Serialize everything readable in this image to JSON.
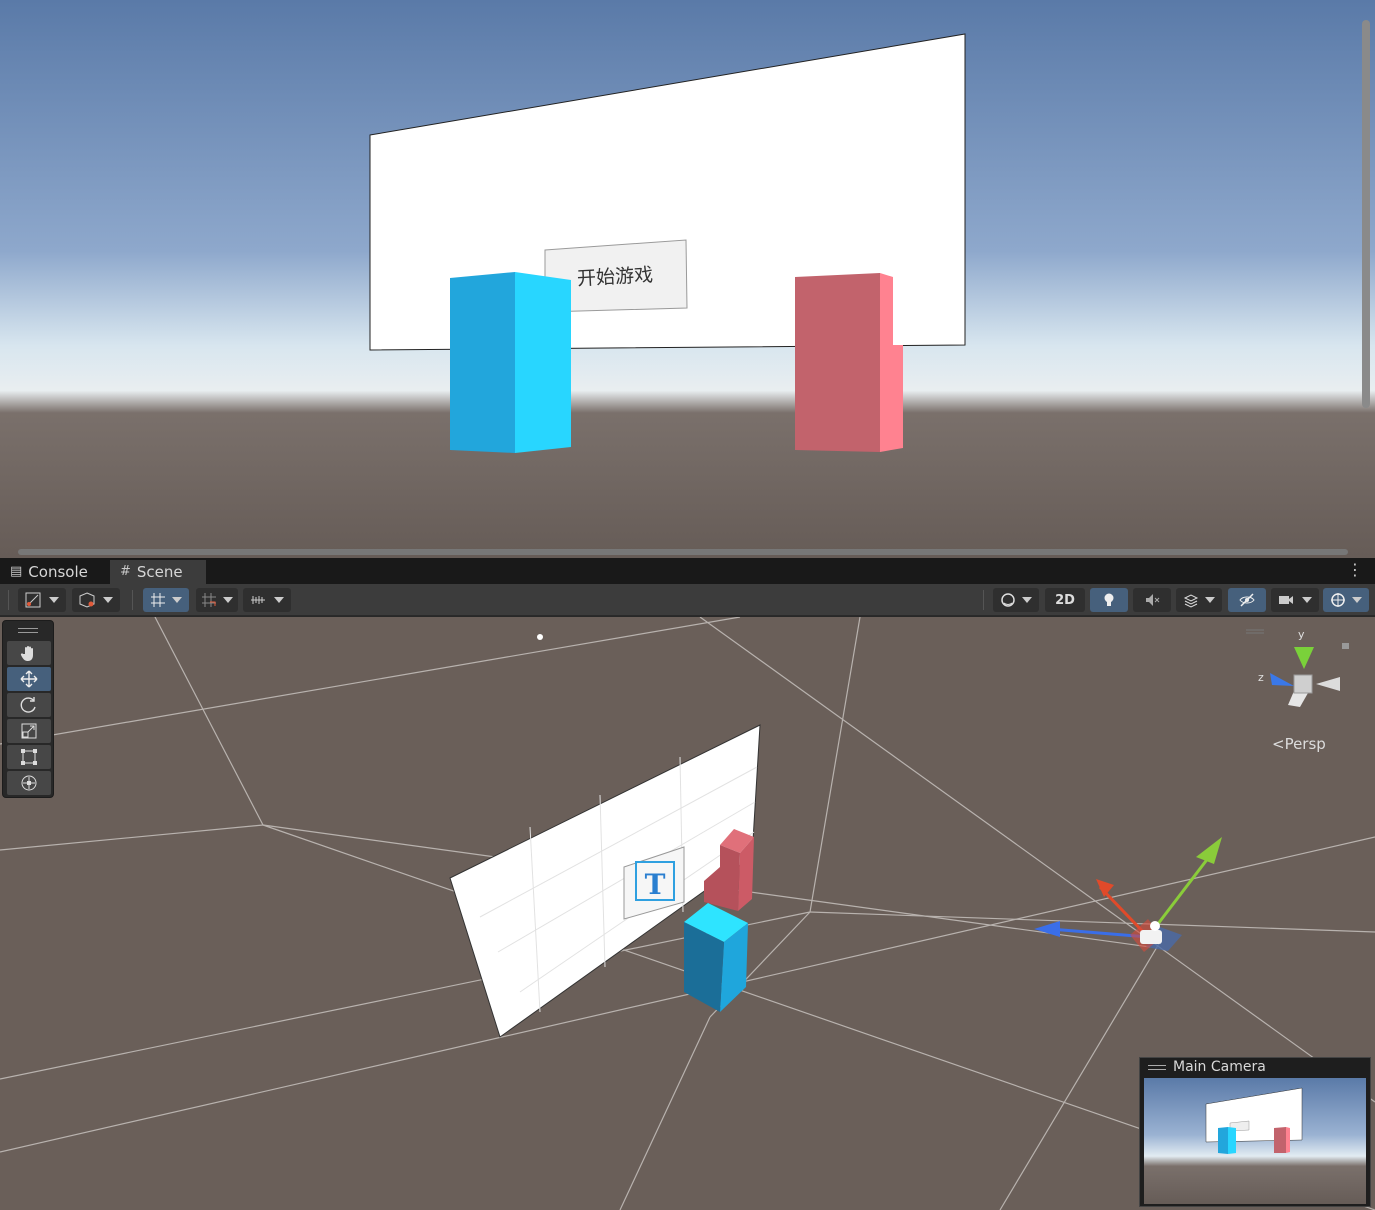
{
  "game_view": {
    "button_label": "开始游戏"
  },
  "tabs": [
    {
      "label": "Console",
      "icon": "console-icon",
      "active": false
    },
    {
      "label": "Scene",
      "icon": "scene-grid-icon",
      "active": true
    }
  ],
  "toolbar": {
    "mode_2d_label": "2D"
  },
  "tools": [
    "hand-tool",
    "move-tool",
    "rotate-tool",
    "scale-tool",
    "rect-tool",
    "transform-tool"
  ],
  "active_tool": "move-tool",
  "gizmo": {
    "y_label": "y",
    "z_label": "z",
    "projection_label": "<Persp"
  },
  "camera_preview": {
    "title": "Main Camera"
  },
  "colors": {
    "blue_cube": "#22b0e6",
    "red_cube": "#c8636b",
    "accent": "#46607c"
  }
}
